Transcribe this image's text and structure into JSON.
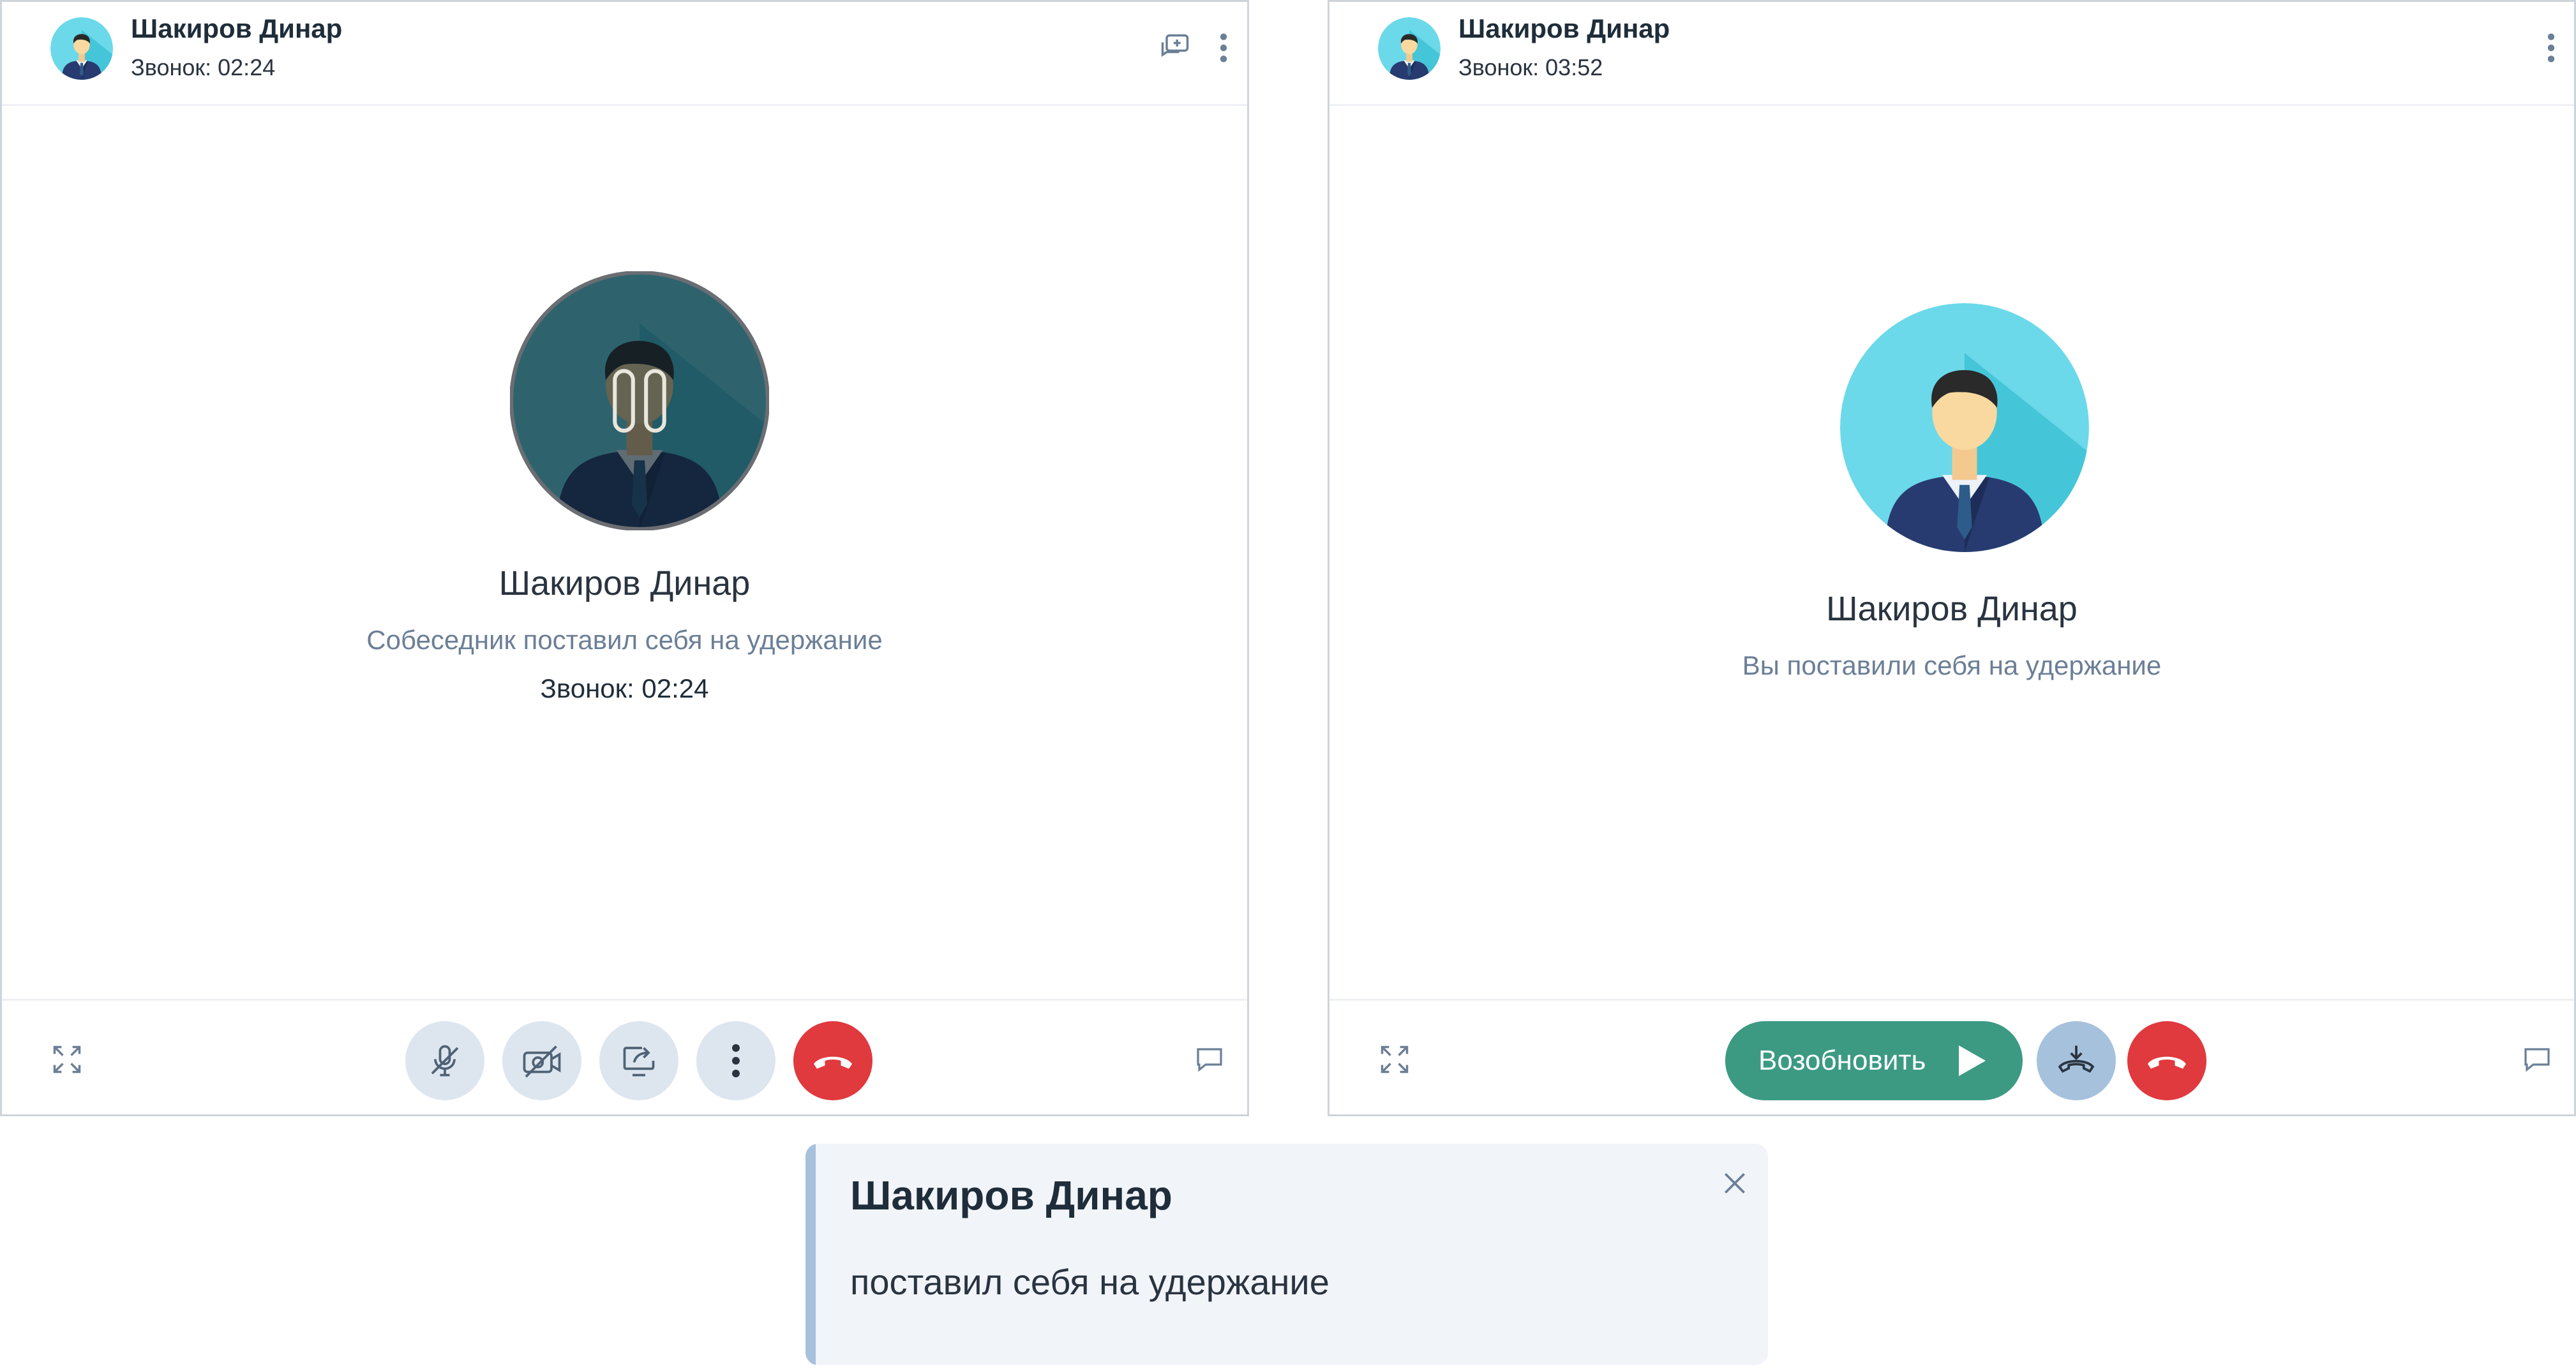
{
  "left_panel": {
    "header": {
      "name": "Шакиров Динар",
      "status": "Звонок: 02:24"
    },
    "body": {
      "name": "Шакиров Динар",
      "status": "Собеседник поставил себя на удержание",
      "timer": "Звонок: 02:24"
    },
    "icons": {
      "header": [
        "chat-add-icon",
        "more-vertical-icon"
      ],
      "footer": [
        "fullscreen-icon",
        "mic-off-icon",
        "video-off-icon",
        "screen-share-icon",
        "more-icon",
        "hangup-icon",
        "chat-icon"
      ]
    }
  },
  "right_panel": {
    "header": {
      "name": "Шакиров Динар",
      "status": "Звонок: 03:52"
    },
    "body": {
      "name": "Шакиров Динар",
      "status": "Вы поставили себя на удержание"
    },
    "footer": {
      "resume_label": "Возобновить"
    },
    "icons": {
      "header": [
        "more-vertical-icon"
      ],
      "footer": [
        "fullscreen-icon",
        "play-icon",
        "transfer-call-icon",
        "hangup-icon",
        "chat-icon"
      ]
    }
  },
  "notification": {
    "title": "Шакиров Динар",
    "text": "поставил себя на удержание"
  },
  "colors": {
    "hangup": "#e0393e",
    "resume": "#3c9a83",
    "control_bg": "#dde6ef",
    "transfer_bg": "#a6c1dc",
    "avatar_bg": "#6bd9ea",
    "muted_text": "#6b7f96"
  }
}
